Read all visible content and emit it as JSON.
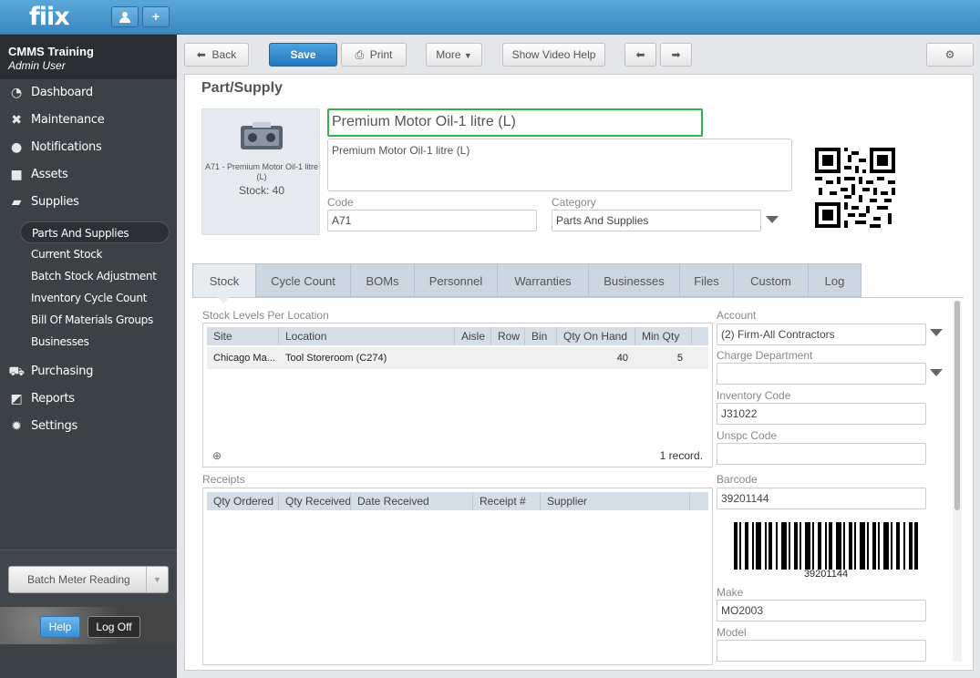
{
  "app": {
    "logo": "fiix"
  },
  "company": {
    "name": "CMMS Training",
    "user": "Admin User"
  },
  "nav": [
    {
      "label": "Dashboard",
      "icon": "dashboard-icon"
    },
    {
      "label": "Maintenance",
      "icon": "wrench-icon"
    },
    {
      "label": "Notifications",
      "icon": "chat-bubble-icon"
    },
    {
      "label": "Assets",
      "icon": "box-icon"
    },
    {
      "label": "Supplies",
      "icon": "truck-icon"
    },
    {
      "label": "Purchasing",
      "icon": "cart-icon"
    },
    {
      "label": "Reports",
      "icon": "chart-icon"
    },
    {
      "label": "Settings",
      "icon": "gear-icon"
    }
  ],
  "supplies_sub": [
    "Parts And Supplies",
    "Current Stock",
    "Batch Stock Adjustment",
    "Inventory Cycle Count",
    "Bill Of Materials Groups",
    "Businesses"
  ],
  "footer": {
    "batch_meter": "Batch Meter Reading",
    "help": "Help",
    "logoff": "Log Off"
  },
  "toolbar": {
    "back": "Back",
    "save": "Save",
    "print": "Print",
    "more": "More",
    "video_help": "Show Video Help"
  },
  "page": {
    "title": "Part/Supply"
  },
  "part": {
    "thumb_label": "A71 - Premium Motor Oil-1 litre (L)",
    "stock_text": "Stock: 40",
    "name": "Premium Motor Oil-1 litre (L)",
    "description": "Premium Motor Oil-1 litre (L)",
    "code_label": "Code",
    "code": "A71",
    "category_label": "Category",
    "category": "Parts And Supplies"
  },
  "tabs": [
    "Stock",
    "Cycle Count",
    "BOMs",
    "Personnel",
    "Warranties",
    "Businesses",
    "Files",
    "Custom",
    "Log"
  ],
  "stock_levels": {
    "title": "Stock Levels Per Location",
    "columns": [
      "Site",
      "Location",
      "Aisle",
      "Row",
      "Bin",
      "Qty On Hand",
      "Min Qty"
    ],
    "rows": [
      {
        "site": "Chicago Ma...",
        "location": "Tool Storeroom (C274)",
        "aisle": "",
        "row": "",
        "bin": "",
        "qty_on_hand": "40",
        "min_qty": "5"
      }
    ],
    "record_count": "1 record."
  },
  "receipts": {
    "title": "Receipts",
    "columns": [
      "Qty Ordered",
      "Qty Received",
      "Date Received",
      "Receipt #",
      "Supplier"
    ]
  },
  "fields": {
    "account_label": "Account",
    "account": "(2) Firm-All Contractors",
    "charge_label": "Charge Department",
    "charge": "",
    "inventory_label": "Inventory Code",
    "inventory": "J31022",
    "unspc_label": "Unspc Code",
    "unspc": "",
    "barcode_label": "Barcode",
    "barcode": "39201144",
    "barcode_text": "39201144",
    "make_label": "Make",
    "make": "MO2003",
    "model_label": "Model",
    "model": ""
  }
}
